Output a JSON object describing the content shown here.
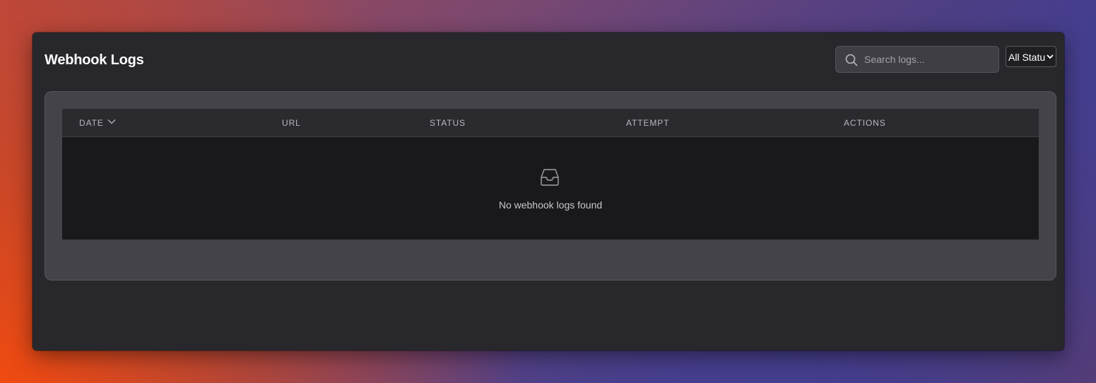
{
  "header": {
    "title": "Webhook Logs"
  },
  "filters": {
    "search_placeholder": "Search logs...",
    "search_value": "",
    "status_selected": "All Statu"
  },
  "table": {
    "columns": [
      {
        "key": "date",
        "label": "DATE",
        "sortable": true
      },
      {
        "key": "url",
        "label": "URL"
      },
      {
        "key": "status",
        "label": "STATUS"
      },
      {
        "key": "attempt",
        "label": "ATTEMPT"
      },
      {
        "key": "actions",
        "label": "ACTIONS"
      }
    ],
    "rows": [],
    "empty_message": "No webhook logs found"
  },
  "icons": {
    "search": "search-icon",
    "sort": "chevron-down-icon",
    "select": "chevron-down-icon",
    "empty": "inbox-icon"
  }
}
